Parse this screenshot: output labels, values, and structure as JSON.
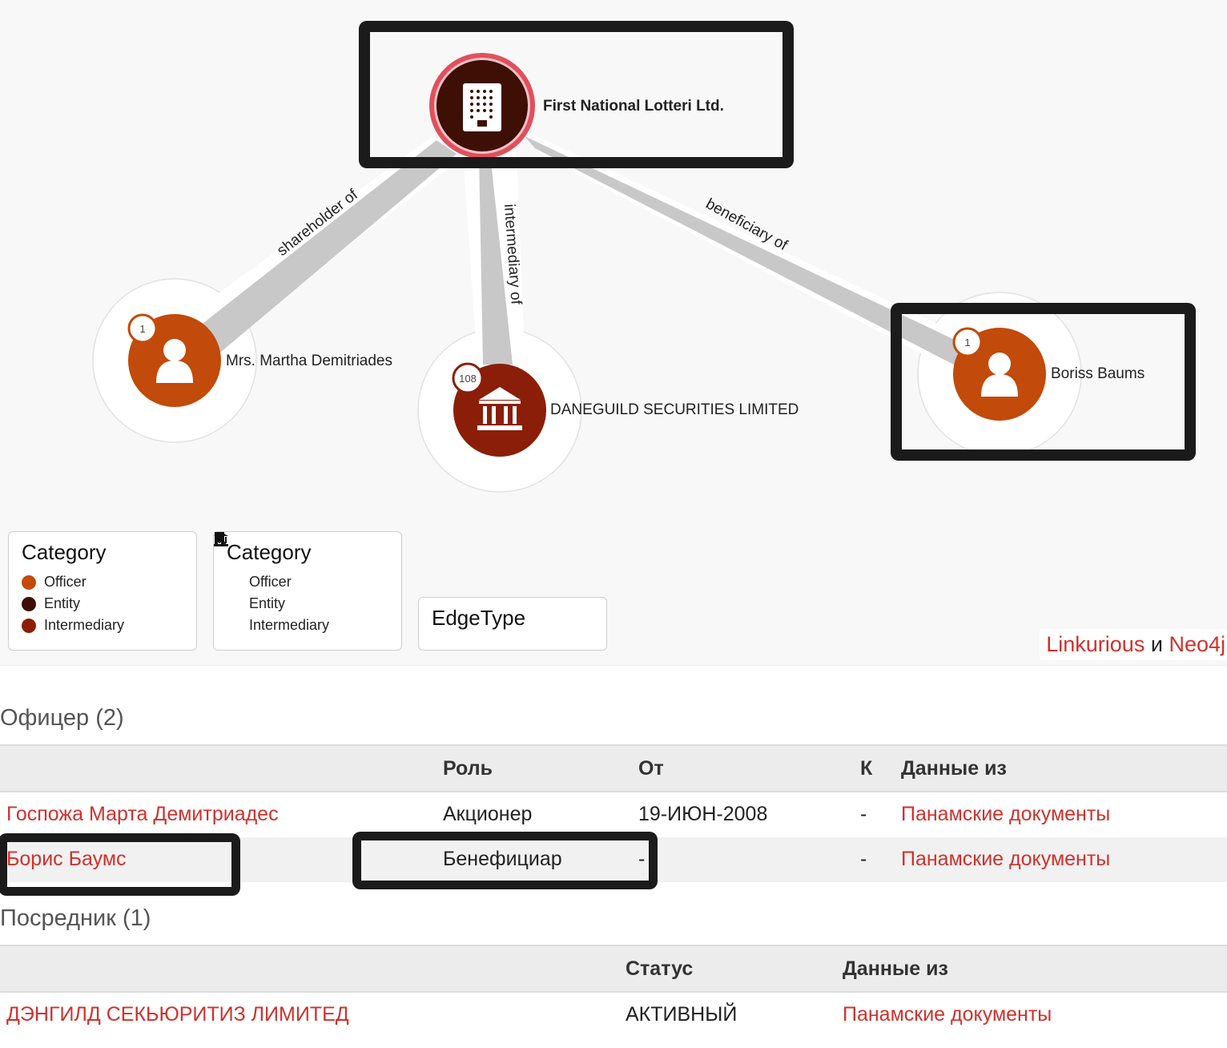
{
  "graph": {
    "nodes": [
      {
        "id": "first-national",
        "label": "First National Lotteri Ltd.",
        "category": "Entity",
        "badge": null,
        "highlighted": true
      },
      {
        "id": "martha",
        "label": "Mrs. Martha Demitriades",
        "category": "Officer",
        "badge": "1",
        "highlighted": false
      },
      {
        "id": "daneguild",
        "label": "DANEGUILD SECURITIES LIMITED",
        "category": "Intermediary",
        "badge": "108",
        "highlighted": false
      },
      {
        "id": "boriss",
        "label": "Boriss Baums",
        "category": "Officer",
        "badge": "1",
        "highlighted": true
      }
    ],
    "edges": [
      {
        "from": "martha",
        "to": "first-national",
        "label": "shareholder of"
      },
      {
        "from": "daneguild",
        "to": "first-national",
        "label": "intermediary of"
      },
      {
        "from": "boriss",
        "to": "first-national",
        "label": "beneficiary of"
      }
    ],
    "colors": {
      "officer": "#c24a0a",
      "entity": "#3d0f05",
      "intermediary": "#8a1e08",
      "selected_ring": "#e0505e",
      "edge": "#c8c8c8",
      "link": "#d0312d"
    }
  },
  "legends": {
    "color_legend": {
      "title": "Category",
      "items": [
        {
          "label": "Officer",
          "color": "#c24a0a"
        },
        {
          "label": "Entity",
          "color": "#3d0f05"
        },
        {
          "label": "Intermediary",
          "color": "#8a1e08"
        }
      ]
    },
    "icon_legend": {
      "title": "Category",
      "items": [
        {
          "label": "Officer",
          "icon": "person-icon"
        },
        {
          "label": "Entity",
          "icon": "building-icon"
        },
        {
          "label": "Intermediary",
          "icon": "bank-icon"
        }
      ]
    },
    "edge_legend": {
      "title": "EdgeType"
    }
  },
  "credits": {
    "link1": "Linkurious",
    "conj": "и",
    "link2": "Neo4j"
  },
  "officers": {
    "title": "Офицер (2)",
    "headers": {
      "name": "",
      "role": "Роль",
      "from": "От",
      "to": "К",
      "source": "Данные из"
    },
    "rows": [
      {
        "name": "Госпожа Марта Демитриадес",
        "role": "Акционер",
        "from": "19-ИЮН-2008",
        "to": "-",
        "source": "Панамские документы"
      },
      {
        "name": "Борис Баумс",
        "role": "Бенефициар",
        "from": "-",
        "to": "-",
        "source": "Панамские документы"
      }
    ]
  },
  "intermediaries": {
    "title": "Посредник (1)",
    "headers": {
      "name": "",
      "status": "Статус",
      "source": "Данные из"
    },
    "rows": [
      {
        "name": "ДЭНГИЛД СЕКЬЮРИТИЗ ЛИМИТЕД",
        "status": "АКТИВНЫЙ",
        "source": "Панамские документы"
      }
    ]
  }
}
